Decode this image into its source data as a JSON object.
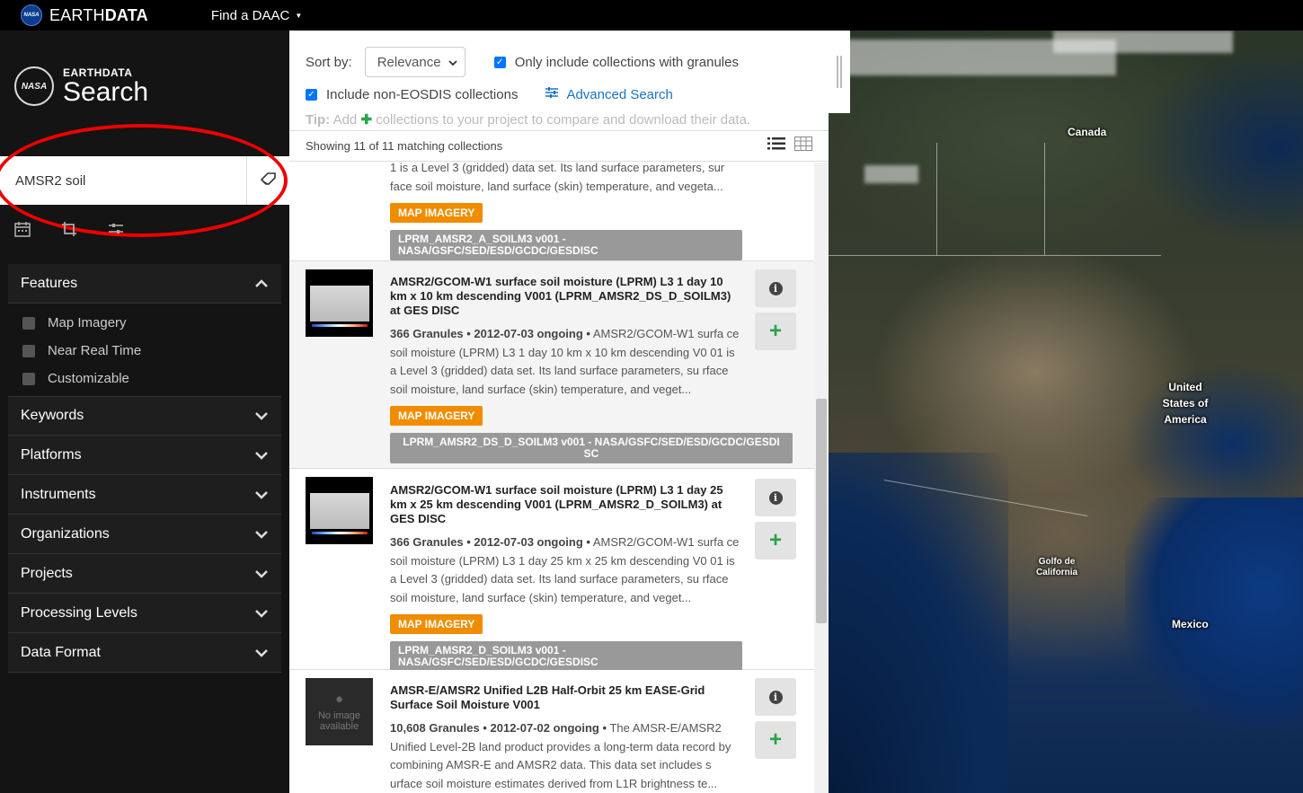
{
  "topbar": {
    "brand_light": "EARTH",
    "brand_bold": "DATA",
    "nasa": "NASA",
    "find_daac": "Find a DAAC"
  },
  "sidebar": {
    "logo_small": "EARTHDATA",
    "logo_big": "Search",
    "nasa": "NASA",
    "search_value": "AMSR2 soil",
    "facets": [
      {
        "label": "Features",
        "expanded": true,
        "options": [
          "Map Imagery",
          "Near Real Time",
          "Customizable"
        ]
      },
      {
        "label": "Keywords"
      },
      {
        "label": "Platforms"
      },
      {
        "label": "Instruments"
      },
      {
        "label": "Organizations"
      },
      {
        "label": "Projects"
      },
      {
        "label": "Processing Levels"
      },
      {
        "label": "Data Format"
      }
    ]
  },
  "results": {
    "sort_label": "Sort by:",
    "sort_value": "Relevance",
    "only_granules": "Only include collections with granules",
    "non_eosdis": "Include non-EOSDIS collections",
    "advanced_search": "Advanced Search",
    "tip_label": "Tip:",
    "tip_add": "Add",
    "tip_rest": "collections to your project to compare and download their data.",
    "showing": "Showing 11 of 11 matching collections",
    "items": [
      {
        "title": "",
        "desc_rest": "1 is a Level 3 (gridded) data set. Its land surface parameters, sur face soil moisture, land surface (skin) temperature, and vegeta...",
        "badge": "MAP IMAGERY",
        "short_name": "LPRM_AMSR2_A_SOILM3 v001 - NASA/GSFC/SED/ESD/GCDC/GESDISC"
      },
      {
        "title": "AMSR2/GCOM-W1 surface soil moisture (LPRM) L3 1 day 10 km x 10 km descending V001 (LPRM_AMSR2_DS_D_SOILM3) at GES DISC",
        "granules": "366 Granules • 2012-07-03 ongoing •",
        "desc_rest": "AMSR2/GCOM-W1 surfa ce soil moisture (LPRM) L3 1 day 10 km x 10 km descending V0 01 is a Level 3 (gridded) data set. Its land surface parameters, su rface soil moisture, land surface (skin) temperature, and veget...",
        "badge": "MAP IMAGERY",
        "short_name": "LPRM_AMSR2_DS_D_SOILM3 v001 - NASA/GSFC/SED/ESD/GCDC/GESDI SC"
      },
      {
        "title": "AMSR2/GCOM-W1 surface soil moisture (LPRM) L3 1 day 25 km x 25 km descending V001 (LPRM_AMSR2_D_SOILM3) at GES DISC",
        "granules": "366 Granules • 2012-07-03 ongoing •",
        "desc_rest": "AMSR2/GCOM-W1 surfa ce soil moisture (LPRM) L3 1 day 25 km x 25 km descending V0 01 is a Level 3 (gridded) data set. Its land surface parameters, su rface soil moisture, land surface (skin) temperature, and veget...",
        "badge": "MAP IMAGERY",
        "short_name": "LPRM_AMSR2_D_SOILM3 v001 - NASA/GSFC/SED/ESD/GCDC/GESDISC"
      },
      {
        "title": "AMSR-E/AMSR2 Unified L2B Half-Orbit 25 km EASE-Grid Surface Soil Moisture V001",
        "granules": "10,608 Granules • 2012-07-02 ongoing •",
        "desc_rest": "The AMSR-E/AMSR2 Unified Level-2B land product provides a long-term data record by combining AMSR-E and AMSR2 data. This data set includes s urface soil moisture estimates derived from L1R brightness te...",
        "no_image": "No image available"
      }
    ]
  },
  "map": {
    "labels": [
      "Canada",
      "United States of America",
      "Golfo de California",
      "Mexico"
    ]
  },
  "colors": {
    "badge": "#f08c00",
    "accent": "#1a73c4",
    "add": "#2aa34a",
    "annotation": "#e00000"
  }
}
